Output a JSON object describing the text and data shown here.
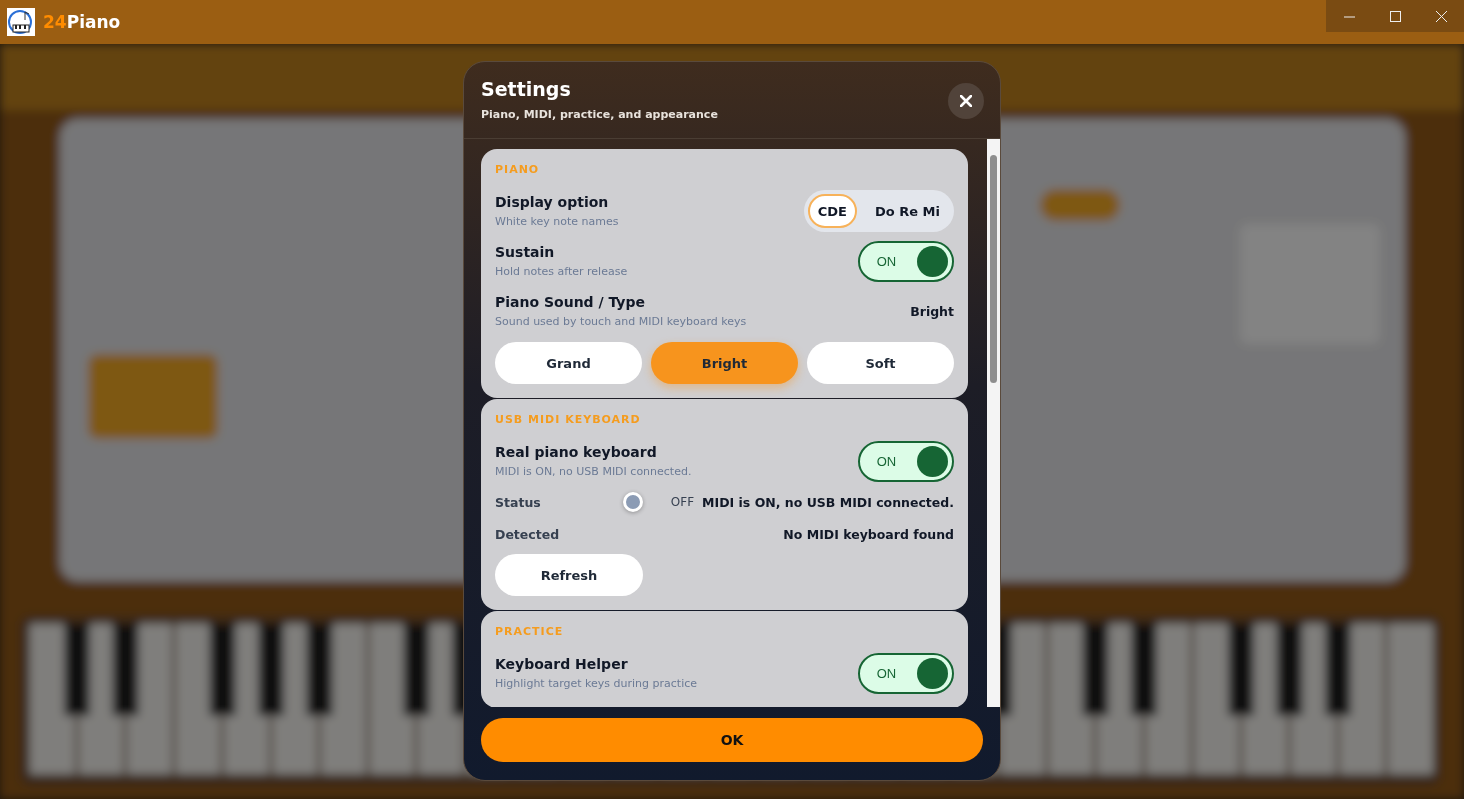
{
  "window": {
    "title_accent": "24",
    "title": "Piano"
  },
  "dialog": {
    "title": "Settings",
    "subtitle": "Piano, MIDI, practice, and appearance",
    "sections": [
      {
        "heading": "PIANO",
        "rows": [
          {
            "kind": "segmented",
            "label": "Display option",
            "description": "White key note names",
            "options": [
              {
                "label": "CDE",
                "selected": true
              },
              {
                "label": "Do Re Mi",
                "selected": false
              }
            ]
          },
          {
            "kind": "toggle",
            "label": "Sustain",
            "description": "Hold notes after release",
            "on": true,
            "state_label": "ON"
          },
          {
            "kind": "choice",
            "label": "Piano Sound / Type",
            "description": "Sound used by touch and MIDI keyboard keys",
            "value": "Bright",
            "options": [
              {
                "label": "Grand",
                "selected": false
              },
              {
                "label": "Bright",
                "selected": true
              },
              {
                "label": "Soft",
                "selected": false
              }
            ]
          }
        ]
      },
      {
        "heading": "USB MIDI KEYBOARD",
        "rows": [
          {
            "kind": "toggle",
            "label": "Real piano keyboard",
            "description": "MIDI is ON, no USB MIDI connected.",
            "on": true,
            "state_label": "ON"
          },
          {
            "kind": "status",
            "label": "Status",
            "on": false,
            "state_label": "OFF",
            "value": "MIDI is ON, no USB MIDI connected."
          },
          {
            "kind": "info",
            "label": "Detected",
            "value": "No MIDI keyboard found"
          },
          {
            "kind": "button",
            "label": "Refresh"
          }
        ]
      },
      {
        "heading": "PRACTICE",
        "rows": [
          {
            "kind": "toggle",
            "label": "Keyboard Helper",
            "description": "Highlight target keys during practice",
            "on": true,
            "state_label": "ON"
          }
        ]
      }
    ],
    "ok_button": "OK"
  }
}
